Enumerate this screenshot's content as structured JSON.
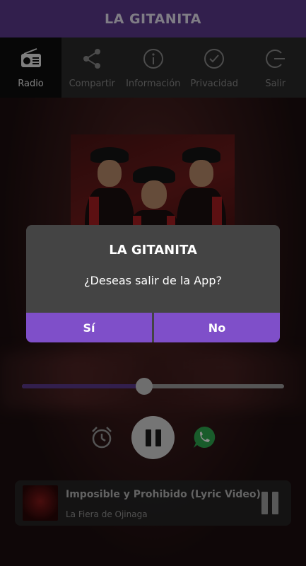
{
  "app": {
    "title": "LA GITANITA"
  },
  "nav": {
    "items": [
      {
        "label": "Radio",
        "icon": "radio-icon",
        "active": true
      },
      {
        "label": "Compartir",
        "icon": "share-icon",
        "active": false
      },
      {
        "label": "Información",
        "icon": "info-icon",
        "active": false
      },
      {
        "label": "Privacidad",
        "icon": "check-circle-icon",
        "active": false
      },
      {
        "label": "Salir",
        "icon": "exit-icon",
        "active": false
      }
    ]
  },
  "player": {
    "progress": 0.466,
    "controls": {
      "timer_icon": "alarm-clock-icon",
      "play_icon": "pause-icon",
      "share_icon": "whatsapp-icon"
    }
  },
  "now_playing": {
    "title": "Imposible y Prohibido (Lyric Video)",
    "artist": "La Fiera de Ojinaga"
  },
  "dialog": {
    "title": "LA GITANITA",
    "message": "¿Deseas salir de la App?",
    "yes_label": "Sí",
    "no_label": "No"
  },
  "colors": {
    "accent": "#5b3a8c",
    "dialog_button": "#7f4fc9",
    "whatsapp": "#2fa84f"
  }
}
